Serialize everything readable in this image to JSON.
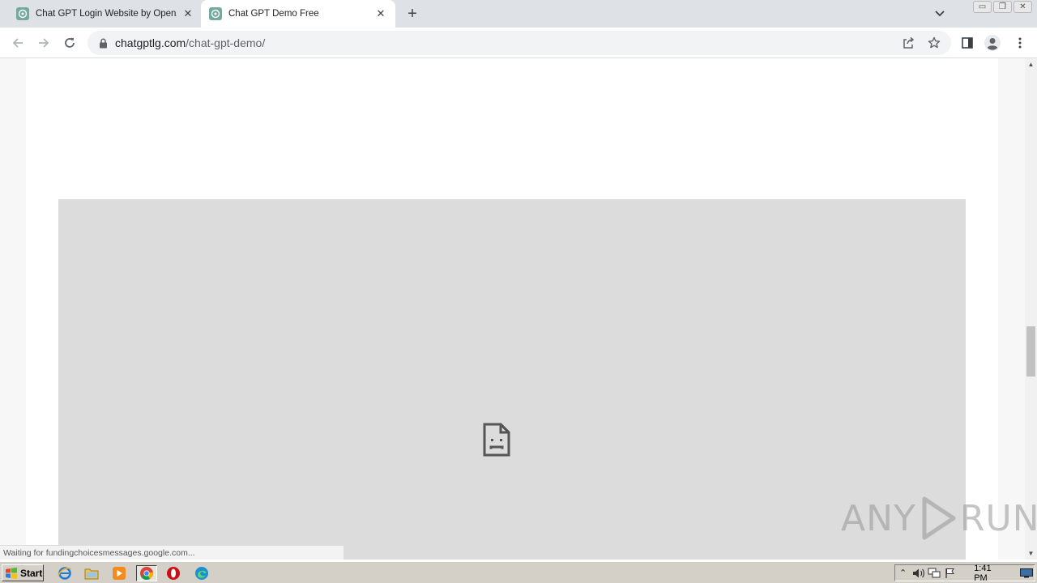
{
  "browser": {
    "tabs": [
      {
        "title": "Chat GPT Login Website by OpenAI",
        "active": false
      },
      {
        "title": "Chat GPT Demo Free",
        "active": true
      }
    ],
    "new_tab_label": "+",
    "close_glyph": "✕",
    "address": {
      "domain": "chatgptlg.com",
      "path": "/chat-gpt-demo/"
    },
    "window_buttons": [
      "▭",
      "❐",
      "✕"
    ]
  },
  "page": {
    "frame_state": "sad-page-icon",
    "status_text": "Waiting for fundingchoicesmessages.google.com..."
  },
  "watermark": {
    "left": "ANY",
    "right": "RUN"
  },
  "taskbar": {
    "start_label": "Start",
    "clock": "1:41 PM",
    "apps": [
      "ie-icon",
      "explorer-icon",
      "media-player-icon",
      "chrome-icon",
      "opera-icon",
      "edge-icon"
    ]
  },
  "colors": {
    "tabstrip": "#dee1e6",
    "frame": "#dcdcdc",
    "taskbar": "#d4d0c8",
    "favicon": "#74aa9c"
  }
}
